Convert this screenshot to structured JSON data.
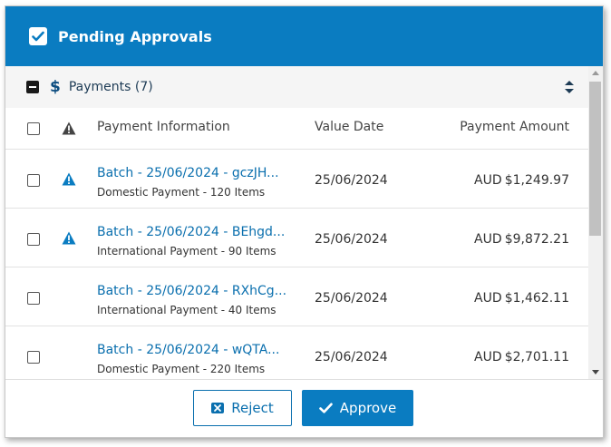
{
  "header": {
    "title": "Pending Approvals"
  },
  "group": {
    "label": "Payments (7)"
  },
  "columns": {
    "info": "Payment Information",
    "date": "Value Date",
    "amount": "Payment Amount"
  },
  "rows": [
    {
      "title": "Batch - 25/06/2024 - gczJH...",
      "subtitle": "Domestic Payment - 120 Items",
      "date": "25/06/2024",
      "currency": "AUD",
      "amount": "$1,249.97",
      "warning": true
    },
    {
      "title": "Batch - 25/06/2024 - BEhgd...",
      "subtitle": "International Payment - 90 Items",
      "date": "25/06/2024",
      "currency": "AUD",
      "amount": "$9,872.21",
      "warning": true
    },
    {
      "title": "Batch - 25/06/2024 - RXhCg...",
      "subtitle": "International Payment - 40 Items",
      "date": "25/06/2024",
      "currency": "AUD",
      "amount": "$1,462.11",
      "warning": false
    },
    {
      "title": "Batch - 25/06/2024 - wQTA...",
      "subtitle": "Domestic Payment - 220 Items",
      "date": "25/06/2024",
      "currency": "AUD",
      "amount": "$2,701.11",
      "warning": false
    }
  ],
  "footer": {
    "reject_label": "Reject",
    "approve_label": "Approve"
  },
  "colors": {
    "brand": "#0a7cc1",
    "link": "#0a6fae",
    "warning": "#0a7cc1"
  },
  "icons": [
    "checkbox-checked-icon",
    "dollar-icon",
    "sort-icon",
    "warning-icon",
    "close-icon",
    "check-icon"
  ]
}
